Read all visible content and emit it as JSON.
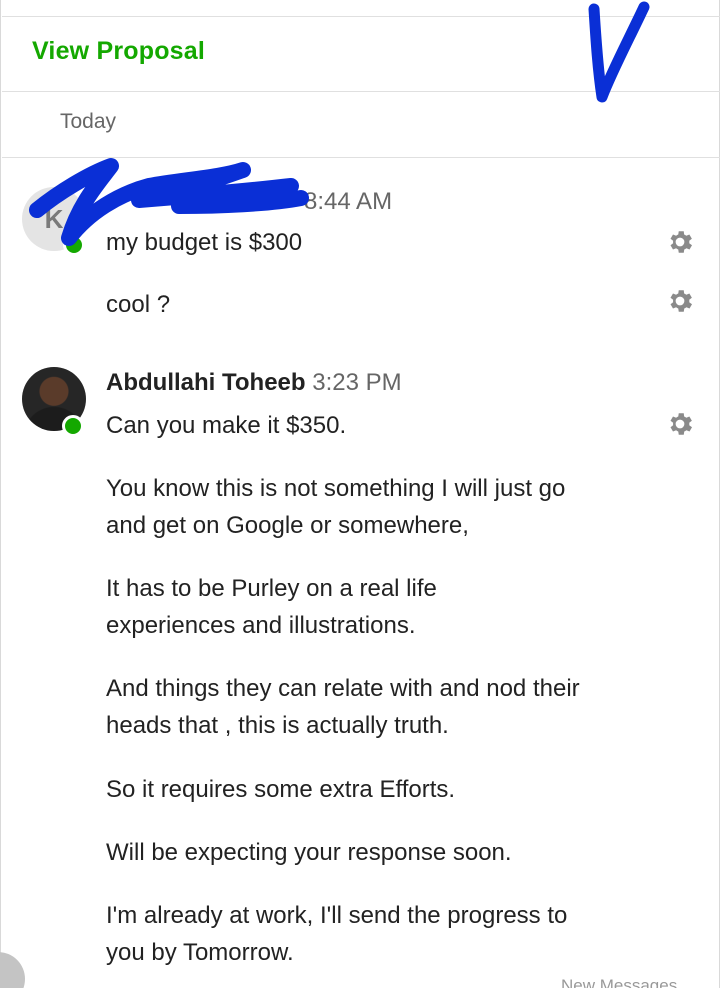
{
  "header": {
    "view_proposal_label": "View Proposal"
  },
  "date_separator": "Today",
  "messages": [
    {
      "sender": "",
      "avatar_initials": "K",
      "time": "8:44 AM",
      "lines": [
        "my budget is $300",
        "cool ?"
      ]
    },
    {
      "sender": "Abdullahi Toheeb",
      "time": "3:23 PM",
      "lines": [
        "Can you make it $350.",
        "You know this is not something I will just go and get on Google or somewhere,",
        "It has to be Purley on a real life experiences and illustrations.",
        "And things they can relate with and nod their heads that , this is actually truth.",
        "So it requires some extra Efforts.",
        "Will be expecting your response soon.",
        "I'm already at work, I'll send the progress to you by Tomorrow."
      ]
    }
  ],
  "footer": {
    "new_messages_label": "New Messages"
  },
  "colors": {
    "accent_green": "#14a800",
    "scribble_blue": "#0a2fd6",
    "gear_gray": "#8a8a8a"
  }
}
